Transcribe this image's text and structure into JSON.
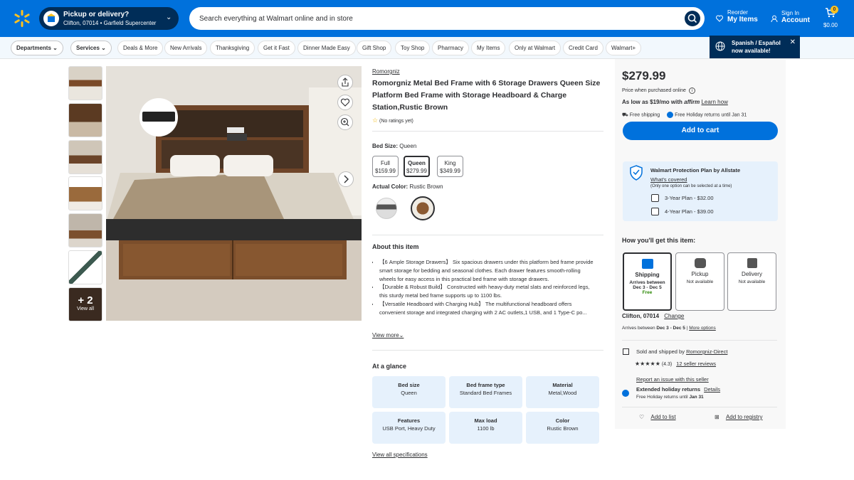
{
  "header": {
    "pickup_title": "Pickup or delivery?",
    "pickup_location": "Clifton, 07014 • Garfield Supercenter",
    "search_placeholder": "Search everything at Walmart online and in store",
    "reorder_top": "Reorder",
    "reorder_bottom": "My Items",
    "signin_top": "Sign In",
    "signin_bottom": "Account",
    "cart_count": "0",
    "cart_total": "$0.00",
    "brand_color": "#0071dc",
    "spark_color": "#ffc220"
  },
  "subnav": {
    "items": [
      "Departments",
      "Services",
      "Deals & More",
      "New Arrivals",
      "Thanksgiving",
      "Get it Fast",
      "Dinner Made Easy",
      "Gift Shop",
      "Toy Shop",
      "Pharmacy",
      "My Items",
      "Only at Walmart",
      "Credit Card",
      "Walmart+"
    ]
  },
  "lang_popup": {
    "text1": "Spanish / Español",
    "text2": "now available!"
  },
  "gallery": {
    "more_count": "+ 2",
    "view_all": "View all"
  },
  "product": {
    "brand": "Romorgniz",
    "title": "Romorgniz Metal Bed Frame with 6 Storage Drawers Queen Size Platform Bed Frame with Storage Headboard & Charge Station,Rustic Brown",
    "ratings": "(No ratings yet)",
    "bed_size_label": "Bed Size:",
    "bed_size_value": "Queen",
    "sizes": [
      {
        "name": "Full",
        "price": "$159.99"
      },
      {
        "name": "Queen",
        "price": "$279.99"
      },
      {
        "name": "King",
        "price": "$349.99"
      }
    ],
    "color_label": "Actual Color:",
    "color_value": "Rustic Brown",
    "about_title": "About this item",
    "bullets": [
      "【6 Ample Storage Drawers】 Six spacious drawers under this platform bed frame provide smart storage for bedding and seasonal clothes. Each drawer features smooth-rolling wheels for easy access in this practical bed frame with storage drawers.",
      "【Durable & Robust Build】 Constructed with heavy-duty metal slats and reinforced legs, this sturdy metal bed frame supports up to 1100 lbs.",
      "【Versatile Headboard with Charging Hub】 The multifunctional headboard offers convenient storage and integrated charging with 2 AC outlets,1 USB, and 1 Type-C po..."
    ],
    "view_more": "View more",
    "glance_title": "At a glance",
    "glance": [
      {
        "label": "Bed size",
        "value": "Queen"
      },
      {
        "label": "Bed frame type",
        "value": "Standard Bed Frames"
      },
      {
        "label": "Material",
        "value": "Metal,Wood"
      },
      {
        "label": "Features",
        "value": "USB Port, Heavy Duty"
      },
      {
        "label": "Max load",
        "value": "1100 lb"
      },
      {
        "label": "Color",
        "value": "Rustic Brown"
      }
    ],
    "view_all_specs": "View all specifications"
  },
  "buybox": {
    "price": "$279.99",
    "price_note": "Price when purchased online",
    "affirm_prefix": "As low as $19/mo with",
    "affirm_brand": "affirm",
    "learn_how": "Learn how",
    "free_shipping": "Free shipping",
    "free_returns": "Free Holiday returns until Jan 31",
    "add_to_cart": "Add to cart",
    "protection_title": "Walmart Protection Plan by Allstate",
    "whats_covered": "What's covered",
    "protection_note": "(Only one option can be selected at a time)",
    "plans": [
      "3-Year Plan - $32.00",
      "4-Year Plan - $39.00"
    ],
    "how_title": "How you'll get this item:",
    "options": [
      {
        "name": "Shipping",
        "l1": "Arrives between",
        "l2": "Dec 3 - Dec 5",
        "l3": "Free"
      },
      {
        "name": "Pickup",
        "l1": "Not available",
        "l2": "",
        "l3": ""
      },
      {
        "name": "Delivery",
        "l1": "Not available",
        "l2": "",
        "l3": ""
      }
    ],
    "location": "Clifton, 07014",
    "change": "Change",
    "arrives_prefix": "Arrives between",
    "arrives_dates": "Dec 3 - Dec 5",
    "more_options": "More options",
    "sold_by_prefix": "Sold and shipped by",
    "seller": "Romorgniz-Direct",
    "seller_rating": "(4.3)",
    "seller_reviews": "12 seller reviews",
    "report": "Report an issue with this seller",
    "ext_returns": "Extended holiday returns",
    "details": "Details",
    "free_holiday_prefix": "Free Holiday returns until",
    "free_holiday_date": "Jan 31",
    "add_to_list": "Add to list",
    "add_to_registry": "Add to registry"
  }
}
